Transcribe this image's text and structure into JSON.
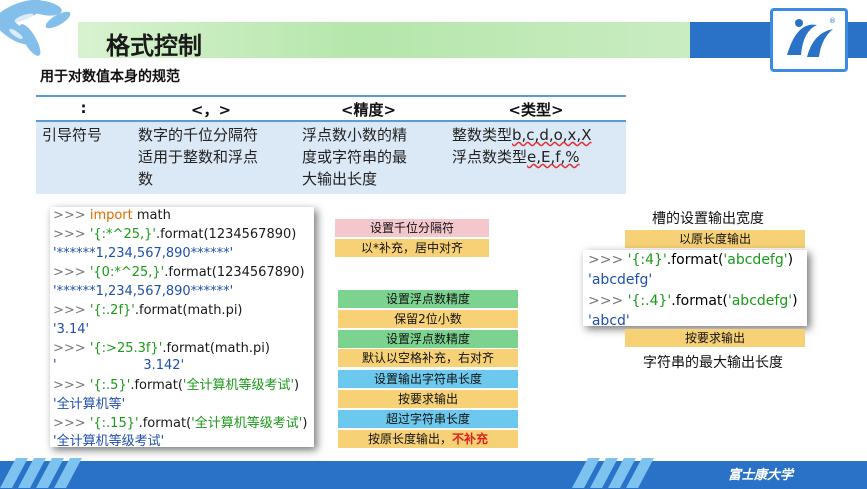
{
  "header": {
    "title": "格式控制",
    "subtitle": "用于对数值本身的规范"
  },
  "table": {
    "headers": [
      ":",
      "<，>",
      "<精度>",
      "<类型>"
    ],
    "row": {
      "col1": "引导符号",
      "col2": [
        "数字的千位分隔符",
        "适用于整数和浮点",
        "数"
      ],
      "col3": [
        "浮点数小数的精",
        "度或字符串的最",
        "大输出长度"
      ],
      "col4_line1_prefix": "整数类型",
      "col4_line1_types": "b,c,d,o,x,X",
      "col4_line2_prefix": "浮点数类型",
      "col4_line2_types": "e,E,f,%"
    }
  },
  "code": {
    "prompt": ">>>",
    "l1_kw": "import",
    "l1_rest": " math",
    "l2_str": "'{:*^25,}'",
    "l2_rest": ".format(1234567890)",
    "l3_out": "'******1,234,567,890******'",
    "l4_str": "'{0:*^25,}'",
    "l4_rest": ".format(1234567890)",
    "l5_out": "'******1,234,567,890******'",
    "l6_str": "'{:.2f}'",
    "l6_rest": ".format(math.pi)",
    "l7_out": "'3.14'",
    "l8_str": "'{:>25.3f}'",
    "l8_rest": ".format(math.pi)",
    "l9_out": "'                     3.142'",
    "l10_str": "'{:.5}'",
    "l10_fmt": ".format(",
    "l10_arg": "'全计算机等级考试'",
    "l10_close": ")",
    "l11_out": "'全计算机等'",
    "l12_str": "'{:.15}'",
    "l12_fmt": ".format(",
    "l12_arg": "'全计算机等级考试'",
    "l12_close": ")",
    "l13_out": "'全计算机等级考试'"
  },
  "labels": {
    "thousands_sep": "设置千位分隔符",
    "star_center": "以*补充，居中对齐",
    "set_precision_1": "设置浮点数精度",
    "keep_2_decimals": "保留2位小数",
    "set_precision_2": "设置浮点数精度",
    "default_space_right": "默认以空格补充，右对齐",
    "set_str_length": "设置输出字符串长度",
    "output_as_required_1": "按要求输出",
    "exceed_str_length": "超过字符串长度",
    "original_length_prefix": "按原长度输出，",
    "no_padding": "不补充"
  },
  "right_panel": {
    "title": "槽的设置输出宽度",
    "original_length_label": "以原长度输出",
    "line1_str": "'{:4}'",
    "line1_fmt": ".format(",
    "line1_arg": "'abcdefg'",
    "line1_close": ")",
    "line2_out": "'abcdefg'",
    "line3_str": "'{:.4}'",
    "line3_fmt": ".format(",
    "line3_arg": "'abcdefg'",
    "line3_close": ")",
    "line4_out": "'abcd'",
    "as_required_label": "按要求输出",
    "bottom_caption": "字符串的最大输出长度"
  },
  "footer": {
    "university": "富士康大学"
  },
  "colors": {
    "accent_blue": "#2a72c7",
    "title_green": "#b5e6ab",
    "label_pink": "#f4c7cd",
    "label_yellow": "#f6d175",
    "label_green": "#7bd38f",
    "label_cyan": "#6cc8ec",
    "warn_red": "#e02020"
  }
}
